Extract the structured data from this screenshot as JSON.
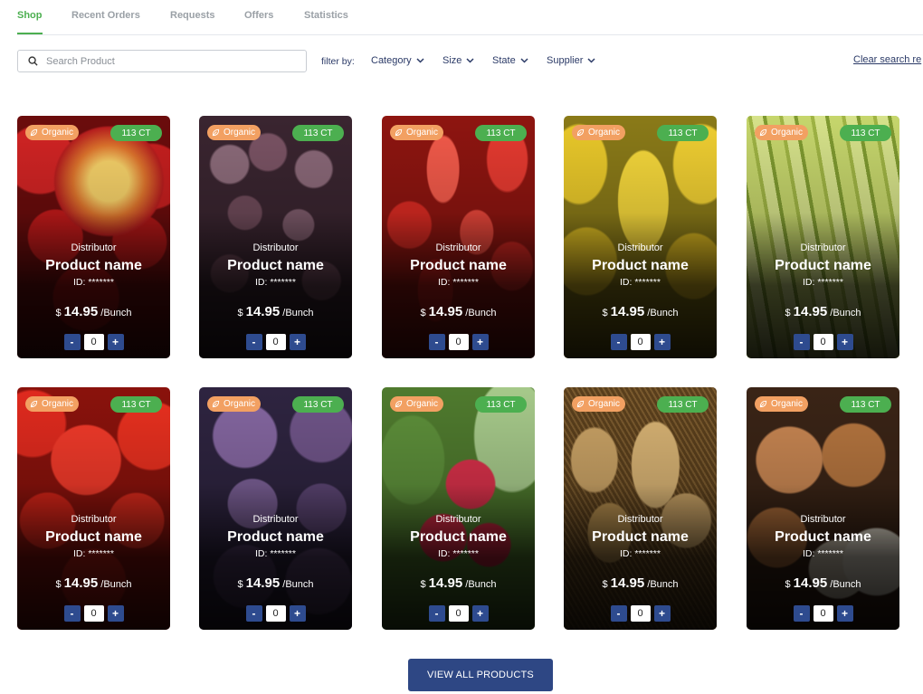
{
  "tabs": [
    {
      "label": "Shop",
      "active": true
    },
    {
      "label": "Recent Orders",
      "active": false
    },
    {
      "label": "Requests",
      "active": false
    },
    {
      "label": "Offers",
      "active": false
    },
    {
      "label": "Statistics",
      "active": false
    }
  ],
  "search": {
    "placeholder": "Search Product",
    "value": ""
  },
  "filters": {
    "label": "filter by:",
    "items": [
      "Category",
      "Size",
      "State",
      "Supplier"
    ],
    "clear_label": "Clear search re"
  },
  "products": [
    {
      "image": "apple",
      "organic_label": "Organic",
      "count_label": "113 CT",
      "distributor": "Distributor",
      "name": "Product name",
      "id": "ID: *******",
      "currency": "$",
      "price": "14.95",
      "unit": "/Bunch",
      "quantity": "0"
    },
    {
      "image": "grapes",
      "organic_label": "Organic",
      "count_label": "113 CT",
      "distributor": "Distributor",
      "name": "Product name",
      "id": "ID: *******",
      "currency": "$",
      "price": "14.95",
      "unit": "/Bunch",
      "quantity": "0"
    },
    {
      "image": "strawberry",
      "organic_label": "Organic",
      "count_label": "113 CT",
      "distributor": "Distributor",
      "name": "Product name",
      "id": "ID: *******",
      "currency": "$",
      "price": "14.95",
      "unit": "/Bunch",
      "quantity": "0"
    },
    {
      "image": "lemon",
      "organic_label": "Organic",
      "count_label": "113 CT",
      "distributor": "Distributor",
      "name": "Product name",
      "id": "ID: *******",
      "currency": "$",
      "price": "14.95",
      "unit": "/Bunch",
      "quantity": "0"
    },
    {
      "image": "zucchini",
      "organic_label": "Organic",
      "count_label": "113 CT",
      "distributor": "Distributor",
      "name": "Product name",
      "id": "ID: *******",
      "currency": "$",
      "price": "14.95",
      "unit": "/Bunch",
      "quantity": "0"
    },
    {
      "image": "tomato",
      "organic_label": "Organic",
      "count_label": "113 CT",
      "distributor": "Distributor",
      "name": "Product name",
      "id": "ID: *******",
      "currency": "$",
      "price": "14.95",
      "unit": "/Bunch",
      "quantity": "0"
    },
    {
      "image": "figs",
      "organic_label": "Organic",
      "count_label": "113 CT",
      "distributor": "Distributor",
      "name": "Product name",
      "id": "ID: *******",
      "currency": "$",
      "price": "14.95",
      "unit": "/Bunch",
      "quantity": "0"
    },
    {
      "image": "pomegranate",
      "organic_label": "Organic",
      "count_label": "113 CT",
      "distributor": "Distributor",
      "name": "Product name",
      "id": "ID: *******",
      "currency": "$",
      "price": "14.95",
      "unit": "/Bunch",
      "quantity": "0"
    },
    {
      "image": "potato",
      "organic_label": "Organic",
      "count_label": "113 CT",
      "distributor": "Distributor",
      "name": "Product name",
      "id": "ID: *******",
      "currency": "$",
      "price": "14.95",
      "unit": "/Bunch",
      "quantity": "0"
    },
    {
      "image": "onion",
      "organic_label": "Organic",
      "count_label": "113 CT",
      "distributor": "Distributor",
      "name": "Product name",
      "id": "ID: *******",
      "currency": "$",
      "price": "14.95",
      "unit": "/Bunch",
      "quantity": "0"
    }
  ],
  "stepper": {
    "minus": "-",
    "plus": "+"
  },
  "view_all_label": "VIEW ALL PRODUCTS",
  "colors": {
    "accent": "#4caf50",
    "primary": "#2e4784",
    "organic_badge": "#f2a062"
  }
}
